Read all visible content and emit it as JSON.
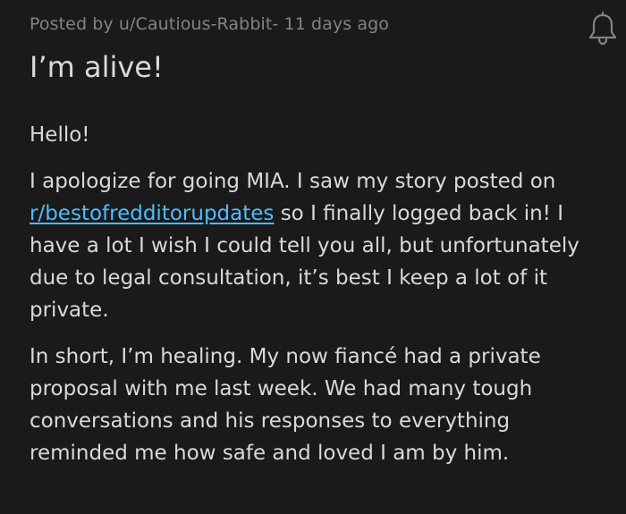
{
  "post": {
    "meta": "Posted by u/Cautious-Rabbit- 11 days ago",
    "title": "I’m alive!",
    "paragraphs": {
      "p1": "Hello!",
      "p2_before": "I apologize for going MIA. I saw my story posted on ",
      "p2_link": "r/bestofredditorupdates",
      "p2_after": " so I finally logged back in! I have a lot I wish I could tell you all, but unfortunately due to legal consultation, it’s best I keep a lot of it private.",
      "p3": "In short, I’m healing. My now fiancé had a private proposal with me last week. We had many tough conversations and his responses to everything reminded me how safe and loved I am by him."
    }
  },
  "icons": {
    "notification": "bell-icon"
  },
  "colors": {
    "background": "#1a1a1b",
    "text": "#d7dadc",
    "meta": "#818384",
    "link": "#4fbcff"
  }
}
